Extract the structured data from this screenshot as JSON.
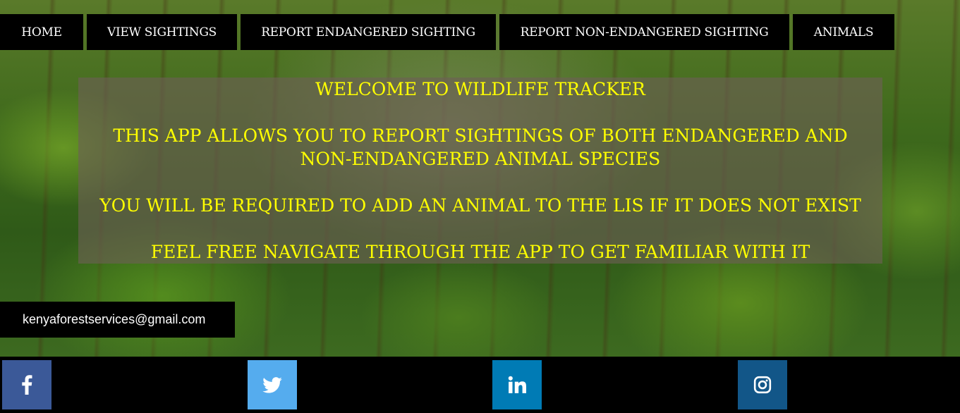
{
  "nav": {
    "items": [
      {
        "label": "HOME"
      },
      {
        "label": "VIEW SIGHTINGS"
      },
      {
        "label": "REPORT ENDANGERED SIGHTING"
      },
      {
        "label": "REPORT NON-ENDANGERED SIGHTING"
      },
      {
        "label": "ANIMALS"
      }
    ]
  },
  "welcome": {
    "title": "WELCOME TO WILDLIFE TRACKER",
    "para1": "THIS APP ALLOWS YOU TO REPORT SIGHTINGS OF BOTH ENDANGERED AND NON-ENDANGERED ANIMAL SPECIES",
    "para2": "YOU WILL BE REQUIRED TO ADD AN ANIMAL TO THE LIS IF IT DOES NOT EXIST",
    "para3": "FEEL FREE NAVIGATE THROUGH THE APP TO GET FAMILIAR WITH IT"
  },
  "contact": {
    "email": "kenyaforestservices@gmail.com"
  },
  "social": {
    "items": [
      {
        "icon": "facebook-icon",
        "color": "#3b5998"
      },
      {
        "icon": "twitter-icon",
        "color": "#55acee"
      },
      {
        "icon": "linkedin-icon",
        "color": "#007bb5"
      },
      {
        "icon": "instagram-icon",
        "color": "#125688"
      }
    ]
  },
  "colors": {
    "accent_text": "#ffff00",
    "nav_bg": "#000000",
    "nav_text": "#ffffff"
  }
}
